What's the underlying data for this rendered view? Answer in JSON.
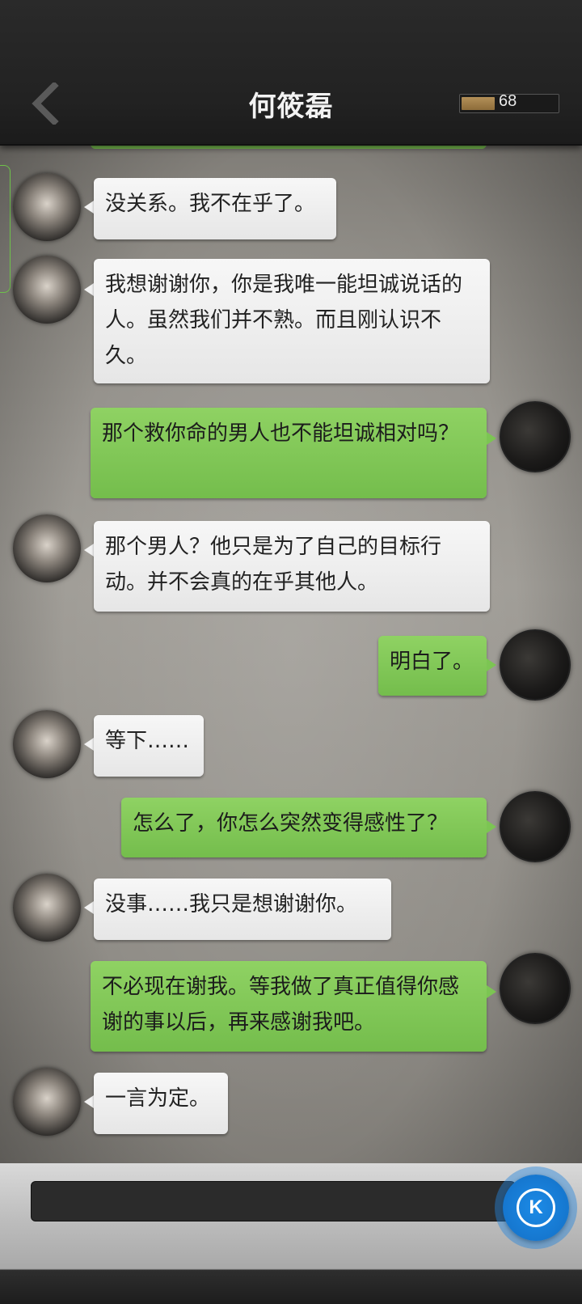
{
  "header": {
    "title": "何筱磊",
    "energy": "68",
    "energy_fraction": 0.35
  },
  "messages": [
    {
      "side": "in",
      "text": "没关系。我不在乎了。"
    },
    {
      "side": "in",
      "text": "我想谢谢你，你是我唯一能坦诚说话的人。虽然我们并不熟。而且刚认识不久。"
    },
    {
      "side": "out",
      "text": "那个救你命的男人也不能坦诚相对吗？"
    },
    {
      "side": "in",
      "text": "那个男人？他只是为了自己的目标行动。并不会真的在乎其他人。"
    },
    {
      "side": "out",
      "text": "明白了。"
    },
    {
      "side": "in",
      "text": "等下……"
    },
    {
      "side": "out",
      "text": "怎么了，你怎么突然变得感性了？"
    },
    {
      "side": "in",
      "text": "没事……我只是想谢谢你。"
    },
    {
      "side": "out",
      "text": "不必现在谢我。等我做了真正值得你感谢的事以后，再来感谢我吧。"
    },
    {
      "side": "in",
      "text": "一言为定。"
    }
  ],
  "composer": {
    "value": "",
    "fab_label": "K"
  },
  "colors": {
    "accent_green": "#7dc552",
    "fab_blue": "#1677cf"
  }
}
